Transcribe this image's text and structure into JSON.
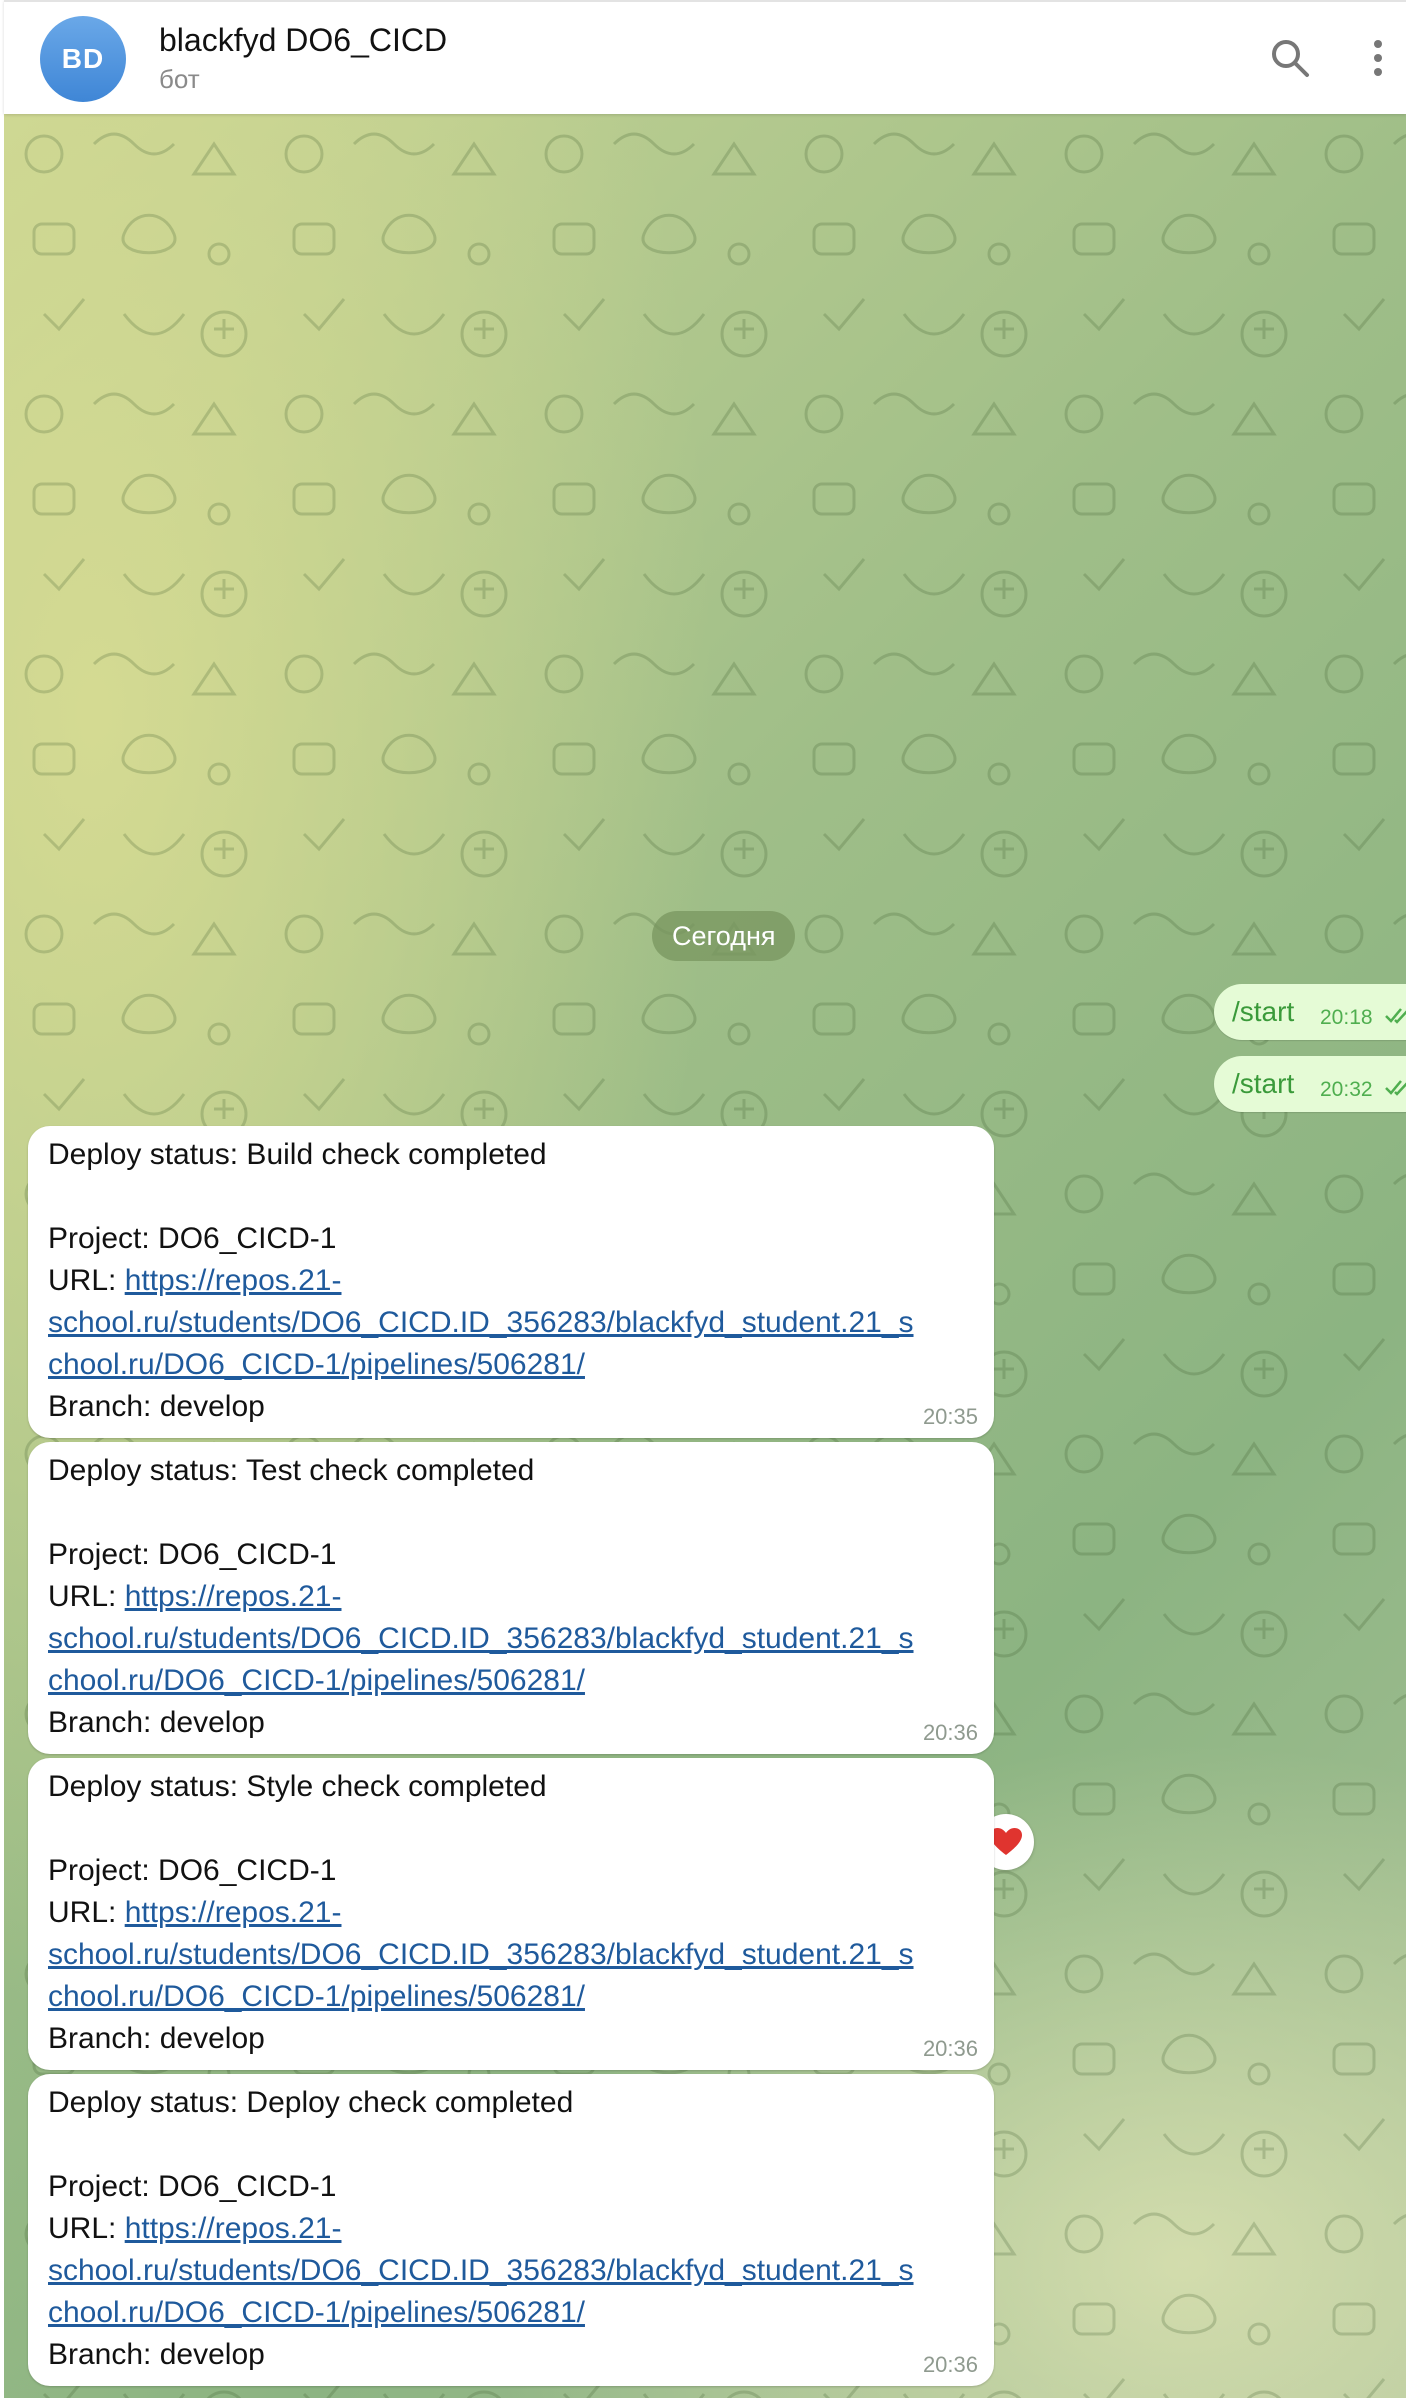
{
  "header": {
    "avatar_initials": "BD",
    "title": "blackfyd DO6_CICD",
    "subtitle": "бот",
    "search_icon": "search-icon",
    "more_icon": "more-vertical-icon"
  },
  "chat": {
    "date_separator": "Сегодня",
    "outgoing": [
      {
        "text": "/start",
        "time": "20:18",
        "status": "read"
      },
      {
        "text": "/start",
        "time": "20:32",
        "status": "read"
      }
    ],
    "messages": [
      {
        "status_line": "Deploy status: Build check completed",
        "project_line": "Project: DO6_CICD-1",
        "url_prefix": "URL: ",
        "url_line1": "https://repos.21-",
        "url_line2": "school.ru/students/DO6_CICD.ID_356283/blackfyd_student.21_s",
        "url_line3": "chool.ru/DO6_CICD-1/pipelines/506281/",
        "branch_line": "Branch: develop",
        "time": "20:35"
      },
      {
        "status_line": "Deploy status: Test check completed",
        "project_line": "Project: DO6_CICD-1",
        "url_prefix": "URL: ",
        "url_line1": "https://repos.21-",
        "url_line2": "school.ru/students/DO6_CICD.ID_356283/blackfyd_student.21_s",
        "url_line3": "chool.ru/DO6_CICD-1/pipelines/506281/",
        "branch_line": "Branch: develop",
        "time": "20:36",
        "reaction": "heart-icon"
      },
      {
        "status_line": "Deploy status: Style check completed",
        "project_line": "Project: DO6_CICD-1",
        "url_prefix": "URL: ",
        "url_line1": "https://repos.21-",
        "url_line2": "school.ru/students/DO6_CICD.ID_356283/blackfyd_student.21_s",
        "url_line3": "chool.ru/DO6_CICD-1/pipelines/506281/",
        "branch_line": "Branch: develop",
        "time": "20:36"
      },
      {
        "status_line": "Deploy status: Deploy check completed",
        "project_line": "Project: DO6_CICD-1",
        "url_prefix": "URL: ",
        "url_line1": "https://repos.21-",
        "url_line2": "school.ru/students/DO6_CICD.ID_356283/blackfyd_student.21_s",
        "url_line3": "chool.ru/DO6_CICD-1/pipelines/506281/",
        "branch_line": "Branch: develop",
        "time": "20:36"
      }
    ]
  },
  "colors": {
    "accent": "#3f86d6",
    "outgoing_bubble": "#e5fbd6",
    "link": "#1f5a9c",
    "reaction": "#e0342f"
  }
}
